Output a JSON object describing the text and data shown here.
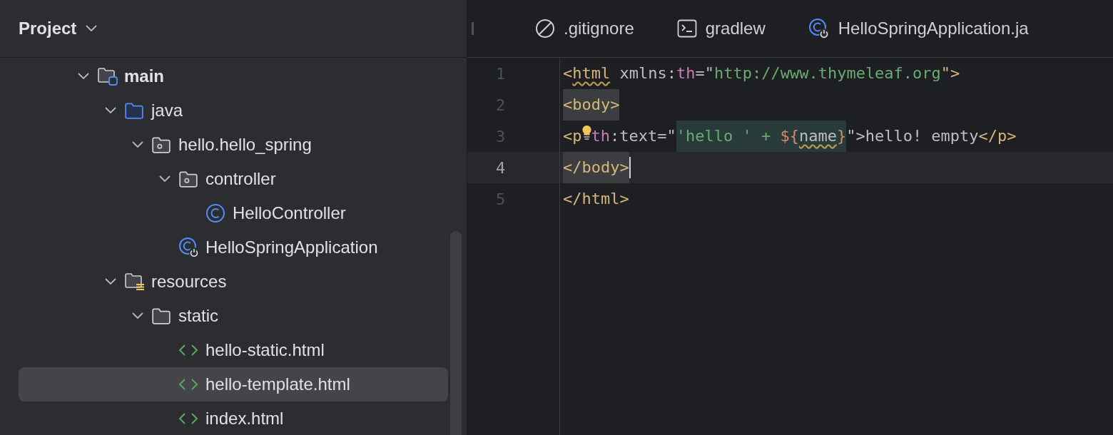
{
  "sidebar": {
    "title": "Project",
    "tree": [
      {
        "label": "main",
        "kind": "source-root",
        "expanded": true,
        "selected": false,
        "children": [
          {
            "label": "java",
            "kind": "source-folder",
            "expanded": true,
            "selected": false,
            "children": [
              {
                "label": "hello.hello_spring",
                "kind": "package",
                "expanded": true,
                "selected": false,
                "children": [
                  {
                    "label": "controller",
                    "kind": "package",
                    "expanded": true,
                    "selected": false,
                    "children": [
                      {
                        "label": "HelloController",
                        "kind": "class",
                        "selected": false
                      }
                    ]
                  },
                  {
                    "label": "HelloSpringApplication",
                    "kind": "spring-class",
                    "selected": false
                  }
                ]
              }
            ]
          },
          {
            "label": "resources",
            "kind": "resources-folder",
            "expanded": true,
            "selected": false,
            "children": [
              {
                "label": "static",
                "kind": "folder",
                "expanded": true,
                "selected": false,
                "children": [
                  {
                    "label": "hello-static.html",
                    "kind": "html",
                    "selected": false
                  },
                  {
                    "label": "hello-template.html",
                    "kind": "html",
                    "selected": true
                  },
                  {
                    "label": "index.html",
                    "kind": "html",
                    "selected": false
                  }
                ]
              }
            ]
          }
        ]
      }
    ]
  },
  "tabs": [
    {
      "label": ".gitignore",
      "kind": "ignore",
      "selected": false
    },
    {
      "label": "gradlew",
      "kind": "terminal",
      "selected": false
    },
    {
      "label": "HelloSpringApplication.ja",
      "kind": "spring-class",
      "selected": false
    }
  ],
  "editor": {
    "lines": [
      {
        "number": "1",
        "current": false,
        "tokens": [
          {
            "text": "<",
            "kind": "tag"
          },
          {
            "text": "html",
            "kind": "tag",
            "warning": true
          },
          {
            "text": " xmlns:",
            "kind": "text"
          },
          {
            "text": "th",
            "kind": "attr"
          },
          {
            "text": "=\"",
            "kind": "text"
          },
          {
            "text": "http://www.thymeleaf.org",
            "kind": "string"
          },
          {
            "text": "\">",
            "kind": "tag"
          }
        ]
      },
      {
        "number": "2",
        "current": false,
        "tokens": [
          {
            "text": "<body>",
            "kind": "tag",
            "highlight": true
          }
        ]
      },
      {
        "number": "3",
        "current": false,
        "bulb": true,
        "tokens": [
          {
            "text": "<p",
            "kind": "tag"
          },
          {
            "text": "th",
            "kind": "attr"
          },
          {
            "text": ":text=\"",
            "kind": "text"
          },
          {
            "text": "'hello ' + ",
            "kind": "string",
            "injected": true
          },
          {
            "text": "${",
            "kind": "expr",
            "injected": true
          },
          {
            "text": "name",
            "kind": "text",
            "injected": true,
            "warning": true
          },
          {
            "text": "}",
            "kind": "expr",
            "injected": true
          },
          {
            "text": "\">",
            "kind": "text"
          },
          {
            "text": "hello! empty",
            "kind": "text"
          },
          {
            "text": "</p>",
            "kind": "tag"
          }
        ]
      },
      {
        "number": "4",
        "current": true,
        "caret": true,
        "tokens": [
          {
            "text": "</body>",
            "kind": "tag",
            "highlight": true
          }
        ]
      },
      {
        "number": "5",
        "current": false,
        "tokens": [
          {
            "text": "</html>",
            "kind": "tag"
          }
        ]
      }
    ]
  }
}
